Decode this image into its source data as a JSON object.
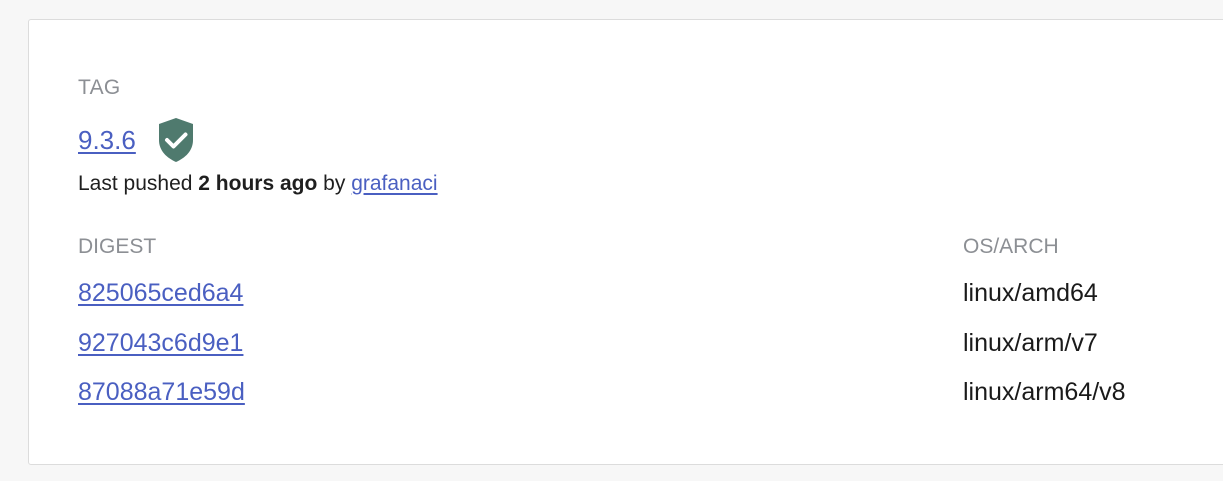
{
  "tag": {
    "section_label": "TAG",
    "name": "9.3.6",
    "badge_icon": "shield-check-icon",
    "badge_color": "#4f7a6e"
  },
  "push_info": {
    "prefix": "Last pushed",
    "time": "2 hours ago",
    "by": "by",
    "user": "grafanaci"
  },
  "table": {
    "headers": {
      "digest": "DIGEST",
      "os_arch": "OS/ARCH"
    },
    "rows": [
      {
        "digest": "825065ced6a4",
        "os_arch": "linux/amd64"
      },
      {
        "digest": "927043c6d9e1",
        "os_arch": "linux/arm/v7"
      },
      {
        "digest": "87088a71e59d",
        "os_arch": "linux/arm64/v8"
      }
    ]
  },
  "colors": {
    "link": "#4a5fc1",
    "muted": "#8c8f94",
    "text": "#1a1a1a"
  }
}
